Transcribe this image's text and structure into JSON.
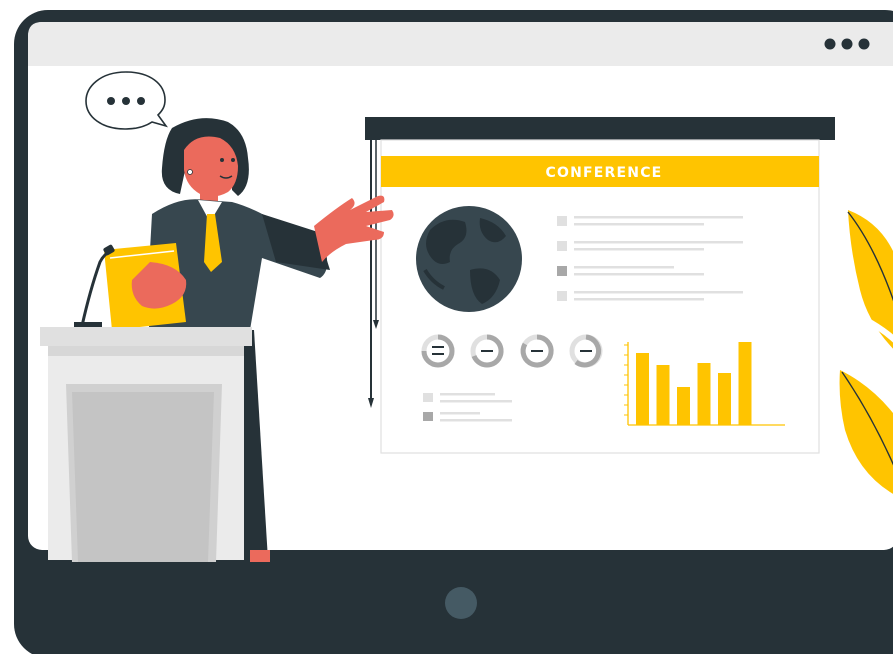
{
  "window": {
    "menu_icon": "ellipsis-icon",
    "home_button_icon": "circle-button-icon"
  },
  "speech_bubble": {
    "icon": "ellipsis-icon"
  },
  "presentation": {
    "title": "CONFERENCE",
    "globe_icon": "globe-icon",
    "bullet_count": 4,
    "gauge_count": 4,
    "legend_count": 2
  },
  "chart_data": {
    "type": "bar",
    "categories": [
      "",
      "",
      "",
      "",
      "",
      ""
    ],
    "values": [
      72,
      60,
      38,
      62,
      52,
      83
    ],
    "ylim": [
      0,
      100
    ],
    "title": "",
    "xlabel": "",
    "ylabel": ""
  },
  "colors": {
    "frame": "#263238",
    "titlebar": "#ebebeb",
    "accent": "#ffc400",
    "skin": "#eb6a5c",
    "podium": "#e0e0e0"
  }
}
